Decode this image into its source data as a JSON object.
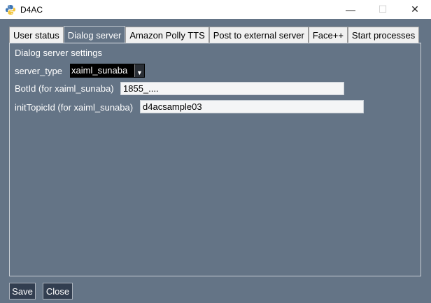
{
  "window": {
    "title": "D4AC",
    "minimize_glyph": "—",
    "maximize_glyph": "☐",
    "close_glyph": "✕"
  },
  "tabs": [
    {
      "label": "User status",
      "active": false
    },
    {
      "label": "Dialog server",
      "active": true
    },
    {
      "label": "Amazon Polly TTS",
      "active": false
    },
    {
      "label": "Post to external server",
      "active": false
    },
    {
      "label": "Face++",
      "active": false
    },
    {
      "label": "Start processes",
      "active": false
    }
  ],
  "panel": {
    "section_title": "Dialog server settings",
    "server_type": {
      "label": "server_type",
      "value": "xaiml_sunaba"
    },
    "bot_id": {
      "label": "BotId (for xaiml_sunaba)",
      "value": "1855_...."
    },
    "init_topic_id": {
      "label": "initTopicId (for xaiml_sunaba)",
      "value": "d4acsample03"
    }
  },
  "buttons": {
    "save_label": "Save",
    "close_label": "Close"
  },
  "colors": {
    "background": "#647486",
    "button_bg": "#323e50",
    "select_bg": "#000000"
  }
}
